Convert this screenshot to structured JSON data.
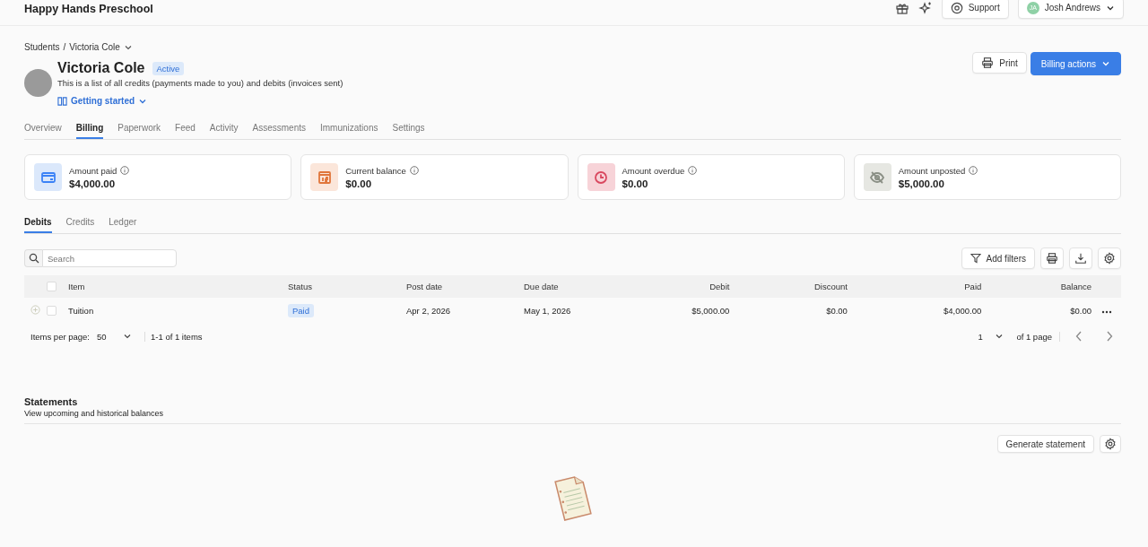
{
  "topbar": {
    "org": "Happy Hands Preschool",
    "support": "Support",
    "user_initials": "JA",
    "user_name": "Josh Andrews"
  },
  "breadcrumb": {
    "parent": "Students",
    "separator": "/",
    "current": "Victoria Cole"
  },
  "header": {
    "name": "Victoria Cole",
    "status": "Active",
    "description": "This is a list of all credits (payments made to you) and debits (invoices sent)",
    "getting_started": "Getting started",
    "print": "Print",
    "billing_actions": "Billing actions"
  },
  "tabs": [
    {
      "label": "Overview",
      "selected": false
    },
    {
      "label": "Billing",
      "selected": true
    },
    {
      "label": "Paperwork",
      "selected": false
    },
    {
      "label": "Feed",
      "selected": false
    },
    {
      "label": "Activity",
      "selected": false
    },
    {
      "label": "Assessments",
      "selected": false
    },
    {
      "label": "Immunizations",
      "selected": false
    },
    {
      "label": "Settings",
      "selected": false
    }
  ],
  "summary_cards": [
    {
      "kind": "card",
      "label": "Amount paid",
      "value": "$4,000.00",
      "color": "#3b82f6"
    },
    {
      "kind": "calendar",
      "label": "Current balance",
      "value": "$0.00",
      "color": "#e0763b"
    },
    {
      "kind": "clock",
      "label": "Amount overdue",
      "value": "$0.00",
      "color": "#d9485f"
    },
    {
      "kind": "hidden",
      "label": "Amount unposted",
      "value": "$5,000.00",
      "color": "#8a8f85"
    }
  ],
  "subtabs": [
    {
      "label": "Debits",
      "selected": true
    },
    {
      "label": "Credits",
      "selected": false
    },
    {
      "label": "Ledger",
      "selected": false
    }
  ],
  "search": {
    "placeholder": "Search"
  },
  "add_filters": "Add filters",
  "table": {
    "select_all_checked": false,
    "columns": [
      "Item",
      "Status",
      "Post date",
      "Due date",
      "Debit",
      "Discount",
      "Paid",
      "Balance"
    ],
    "rows": [
      {
        "checked": false,
        "item": "Tuition",
        "status": "Paid",
        "post_date": "Apr 2, 2026",
        "due_date": "May 1, 2026",
        "debit": "$5,000.00",
        "discount": "$0.00",
        "paid": "$4,000.00",
        "balance": "$0.00"
      }
    ]
  },
  "pagination": {
    "items_per_page_label": "Items per page:",
    "items_per_page": "50",
    "range": "1-1 of 1 items",
    "page": "1",
    "of_pages": "of 1 page"
  },
  "statements": {
    "title": "Statements",
    "subtitle": "View upcoming and historical balances",
    "generate": "Generate statement"
  }
}
